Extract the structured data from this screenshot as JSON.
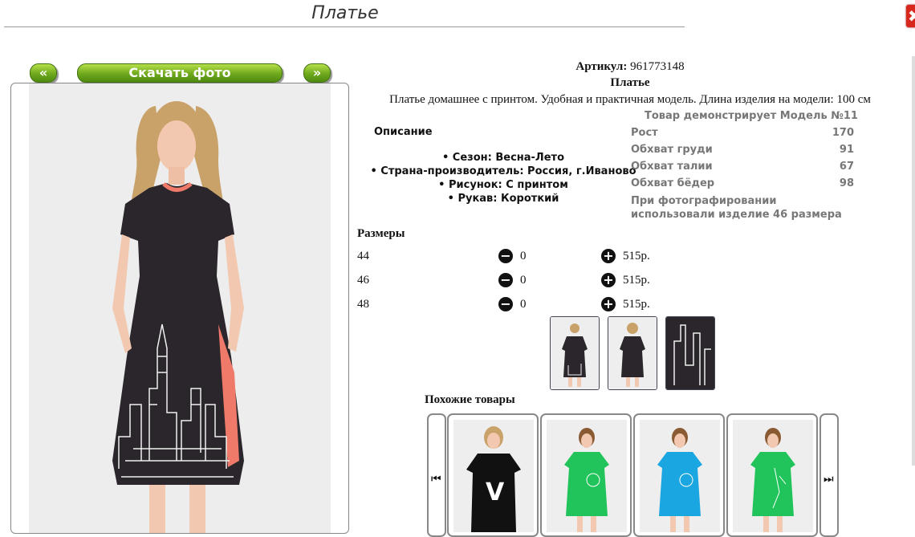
{
  "page": {
    "title": "Платье",
    "close_label": "✖"
  },
  "photo_nav": {
    "prev_label": "«",
    "download_label": "Скачать фото",
    "next_label": "»"
  },
  "product": {
    "article_label": "Артикул:",
    "article_value": "961773148",
    "name": "Платье",
    "description": "Платье домашнее с принтом. Удобная и практичная модель. Длина изделия на модели: 100 см",
    "desc_title": "Описание",
    "properties": [
      "• Сезон: Весна-Лето",
      "• Страна-производитель: Россия, г.Иваново",
      "• Рисунок: С принтом",
      "• Рукав: Короткий"
    ]
  },
  "model": {
    "title": "Товар демонстрирует Модель №11",
    "rows": [
      {
        "label": "Рост",
        "value": "170"
      },
      {
        "label": "Обхват груди",
        "value": "91"
      },
      {
        "label": "Обхват талии",
        "value": "67"
      },
      {
        "label": "Обхват бёдер",
        "value": "98"
      }
    ],
    "note": "При фотографировании использовали изделие 46 размера"
  },
  "sizes": {
    "title": "Размеры",
    "rows": [
      {
        "size": "44",
        "qty": "0",
        "price": "515р."
      },
      {
        "size": "46",
        "qty": "0",
        "price": "515р."
      },
      {
        "size": "48",
        "qty": "0",
        "price": "515р."
      }
    ]
  },
  "similar": {
    "title": "Похожие товары",
    "prev_icon": "⏮",
    "next_icon": "⏭"
  },
  "colors": {
    "accent_green": "#6ea81c",
    "close_red": "#d8271c",
    "dress_dark": "#2a262b",
    "dress_trim": "#f07a6a",
    "similar_green": "#21c45a",
    "similar_blue": "#1aa6e0"
  }
}
